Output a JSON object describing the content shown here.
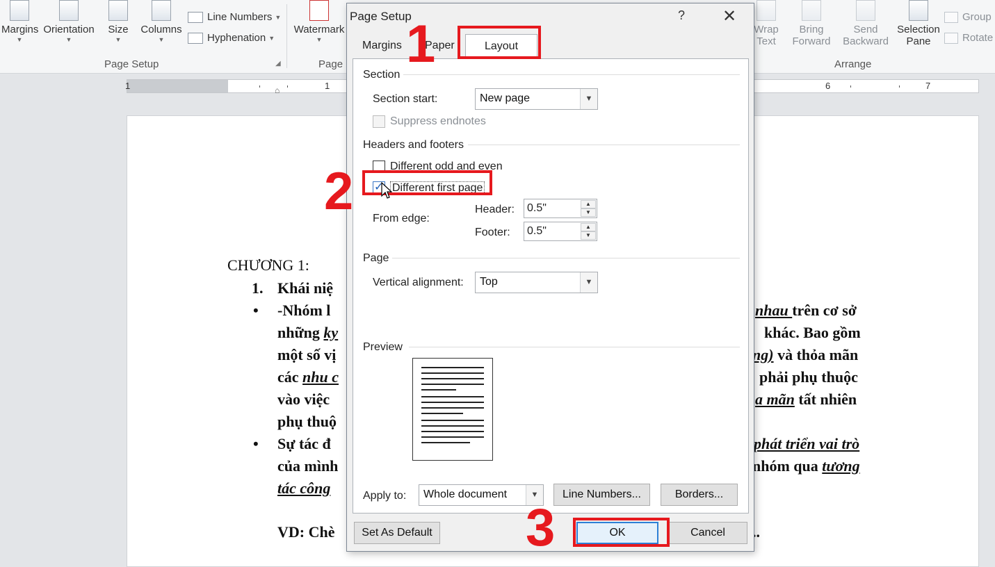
{
  "ribbon": {
    "groups": {
      "page_setup": {
        "label": "Page Setup",
        "margins": "Margins",
        "orientation": "Orientation",
        "size": "Size",
        "columns": "Columns",
        "line_numbers": "Line Numbers",
        "hyphenation": "Hyphenation"
      },
      "page_background": {
        "label": "Page",
        "watermark": "Watermark"
      },
      "arrange": {
        "label": "Arrange",
        "wrap_text_1": "Wrap",
        "wrap_text_2": "Text",
        "bring_forward_1": "Bring",
        "bring_forward_2": "Forward",
        "send_backward_1": "Send",
        "send_backward_2": "Backward",
        "selection_pane_1": "Selection",
        "selection_pane_2": "Pane",
        "group": "Group",
        "rotate": "Rotate"
      }
    }
  },
  "ruler": {
    "numbers": [
      "1",
      "1",
      "6",
      "7"
    ]
  },
  "document": {
    "chapter": "CHƯƠNG 1:",
    "item1_num": "1.",
    "item1_text": "Khái niệ",
    "bullet": "•",
    "l1_left": "-Nhóm l",
    "l1_right_a": "nhau ",
    "l1_right_b": "trên cơ sở",
    "l2_left_a": "những ",
    "l2_left_b": "ky",
    "l2_right": "khác. Bao gồm",
    "l3_left": "một số vị",
    "l3_right_a": "ng)",
    "l3_right_b": " và thỏa mãn",
    "l4_left_a": "các ",
    "l4_left_b": "nhu c",
    "l4_right": "phải phụ thuộc",
    "l5_left": "vào việc",
    "l5_right_a": "a mãn",
    "l5_right_b": " tất nhiên",
    "l6_left": "phụ thuộ",
    "l7_left": "Sự tác đ",
    "l7_right": "phát triển vai trò",
    "l8_left": "của mình",
    "l8_right_a": "nhóm qua ",
    "l8_right_b": "tương",
    "l9_left": "tác công",
    "vd": "VD: Chè",
    "vd_right": ".."
  },
  "dialog": {
    "title": "Page Setup",
    "help": "?",
    "close": "✕",
    "tabs": {
      "margins": "Margins",
      "paper": "Paper",
      "layout": "Layout"
    },
    "section": {
      "title": "Section",
      "start_label": "Section start:",
      "start_value": "New page",
      "suppress_endnotes": "Suppress endnotes"
    },
    "headers_footers": {
      "title": "Headers and footers",
      "odd_even": "Different odd and even",
      "first_page": "Different first page",
      "from_edge": "From edge:",
      "header_label": "Header:",
      "header_value": "0.5\"",
      "footer_label": "Footer:",
      "footer_value": "0.5\""
    },
    "page": {
      "title": "Page",
      "valign_label": "Vertical alignment:",
      "valign_value": "Top"
    },
    "preview": {
      "title": "Preview"
    },
    "apply_to_label": "Apply to:",
    "apply_to_value": "Whole document",
    "line_numbers_btn": "Line Numbers...",
    "borders_btn": "Borders...",
    "default_btn": "Set As Default",
    "ok_btn": "OK",
    "cancel_btn": "Cancel"
  },
  "annotations": {
    "step1": "1",
    "step2": "2",
    "step3": "3"
  },
  "colors": {
    "annotation_red": "#e6191e",
    "focus_blue": "#2d7fd6"
  }
}
